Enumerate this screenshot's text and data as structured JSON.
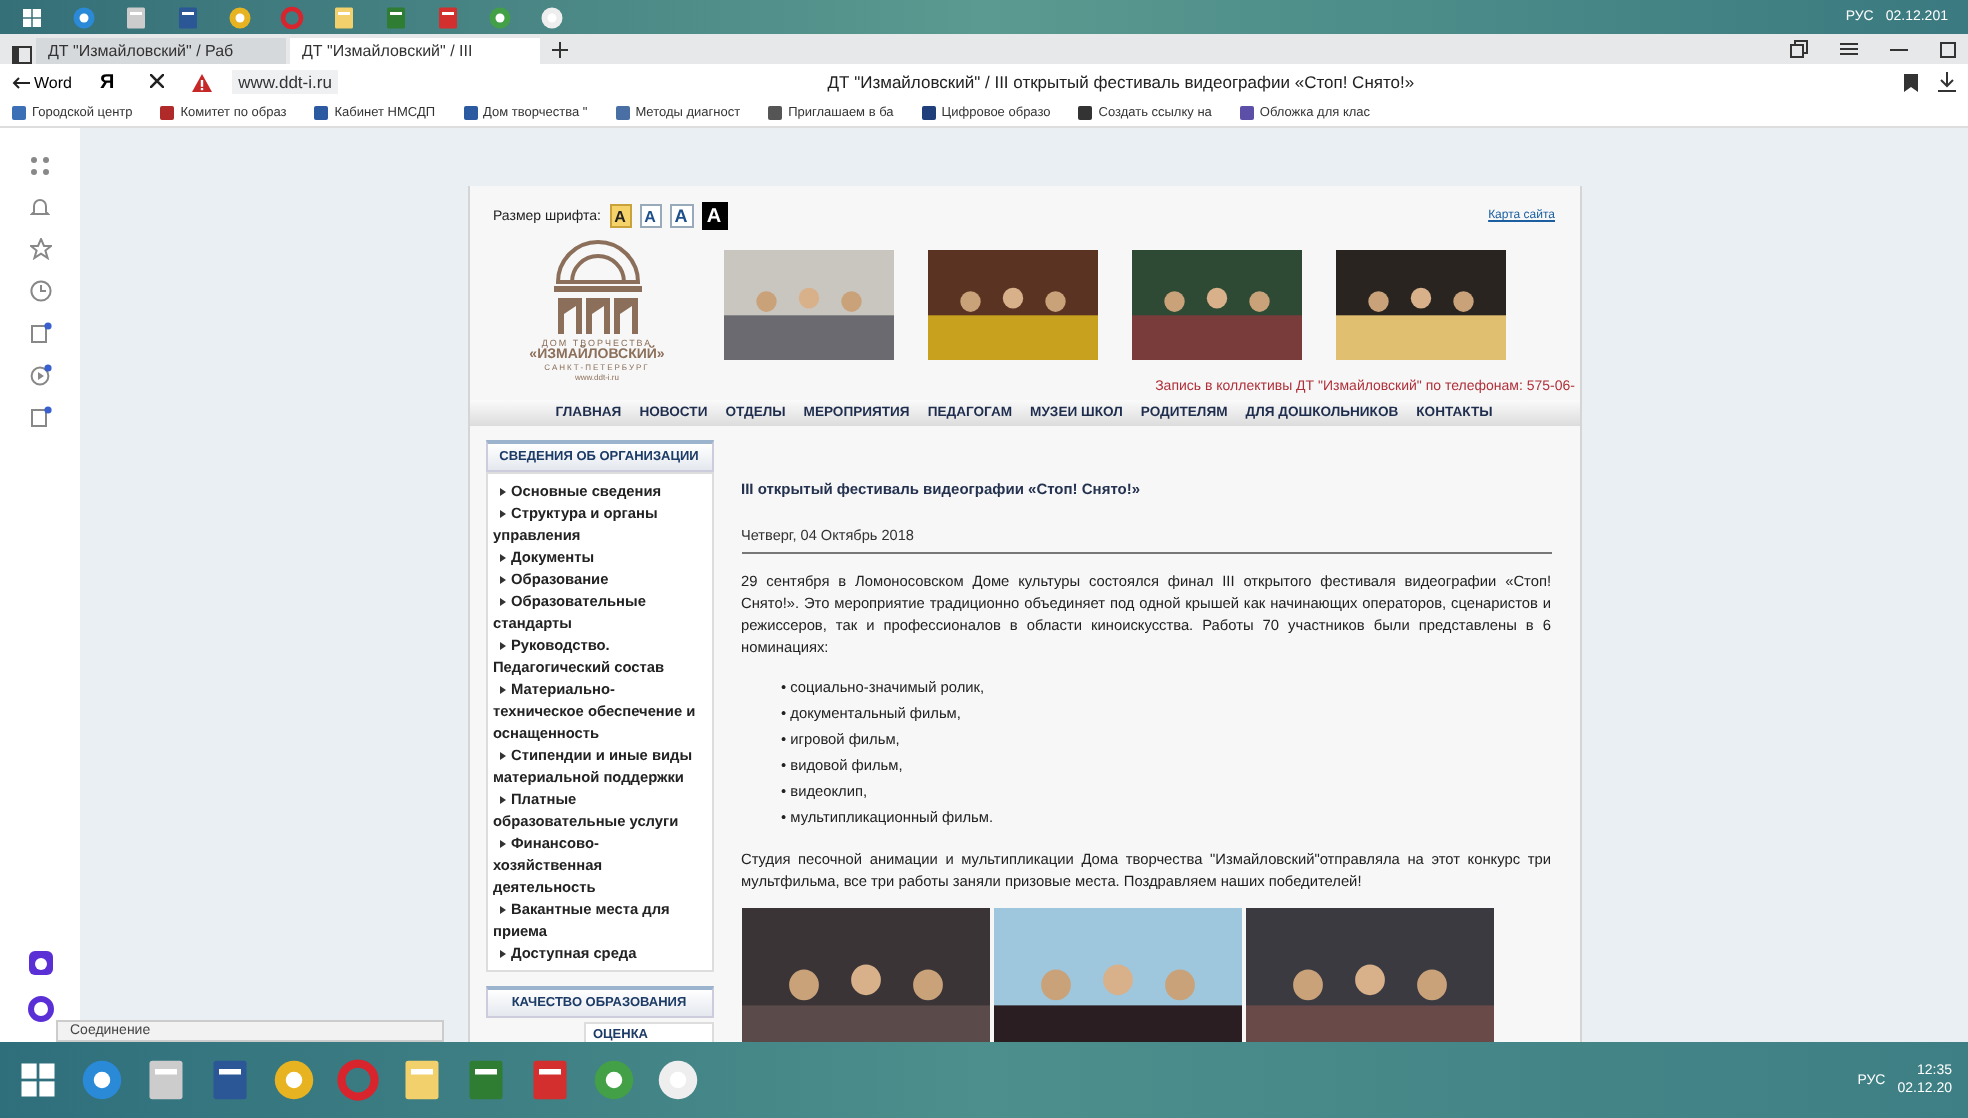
{
  "system_tray_top": {
    "language": "РУС",
    "date": "02.12.201"
  },
  "browser": {
    "tabs": [
      {
        "label": "ДТ \"Измайловский\" / Раб",
        "selected": false
      },
      {
        "label": "ДТ \"Измайловский\" / III",
        "selected": true
      }
    ],
    "back_label": "Word",
    "home_letter": "Я",
    "url": "www.ddt-i.ru",
    "page_title": "ДТ \"Измайловский\" / III открытый фестиваль видеографии «Стоп! Снято!»",
    "bookmarks": [
      {
        "label": "Городской центр",
        "color": "#3b6fb6"
      },
      {
        "label": "Комитет по образ",
        "color": "#b02a2a"
      },
      {
        "label": "Кабинет НМСДП",
        "color": "#2c5aa0"
      },
      {
        "label": "Дом творчества \"",
        "color": "#2c5aa0"
      },
      {
        "label": "Методы диагност",
        "color": "#4a6fa5"
      },
      {
        "label": "Приглашаем в ба",
        "color": "#555555"
      },
      {
        "label": "Цифровое образо",
        "color": "#1f3f7a"
      },
      {
        "label": "Создать ссылку на",
        "color": "#333333"
      },
      {
        "label": "Обложка для клас",
        "color": "#5b4fa8"
      }
    ]
  },
  "page": {
    "font_size_label": "Размер шрифта:",
    "font_size_buttons": [
      {
        "label": "A",
        "kind": "highlight"
      },
      {
        "label": "A",
        "kind": "plain"
      },
      {
        "label": "A",
        "kind": "large"
      },
      {
        "label": "A",
        "kind": "inverse"
      }
    ],
    "sitemap_link": "Карта сайта",
    "logo": {
      "line_1": "ДОМ ТВОРЧЕСТВА",
      "line_2": "«ИЗМАЙЛОВСКИЙ»",
      "line_3": "САНКТ-ПЕТЕРБУРГ",
      "line_4": "www.ddt-i.ru"
    },
    "enrollment_note": "Запись в коллективы ДТ \"Измайловский\" по телефонам: 575-06-",
    "nav": [
      "ГЛАВНАЯ",
      "НОВОСТИ",
      "ОТДЕЛЫ",
      "МЕРОПРИЯТИЯ",
      "ПЕДАГОГАМ",
      "МУЗЕИ ШКОЛ",
      "РОДИТЕЛЯМ",
      "ДЛЯ ДОШКОЛЬНИКОВ",
      "КОНТАКТЫ"
    ],
    "sidebar": {
      "sections": [
        {
          "title": "СВЕДЕНИЯ ОБ ОРГАНИЗАЦИИ",
          "items": [
            "Основные сведения",
            "Структура и органы управления",
            "Документы",
            "Образование",
            "Образовательные стандарты",
            "Руководство. Педагогический состав",
            "Материально-техническое обеспечение и оснащенность",
            "Стипендии и иные виды материальной поддержки",
            "Платные образовательные услуги",
            "Финансово-хозяйственная деятельность",
            "Вакантные места для приема",
            "Доступная среда"
          ]
        },
        {
          "title": "КАЧЕСТВО ОБРАЗОВАНИЯ"
        }
      ],
      "sub_heading": "ОЦЕНКА"
    },
    "article": {
      "title": "III открытый фестиваль видеографии «Стоп! Снято!»",
      "date": "Четверг, 04 Октябрь 2018",
      "intro": "29 сентября в Ломоносовском Доме культуры состоялся финал III открытого фестиваля видеографии «Стоп! Снято!». Это мероприятие традиционно объединяет под одной крышей как начинающих операторов, сценаристов и режиссеров, так и профессионалов в области киноискусства. Работы 70 участников были представлены в 6 номинациях:",
      "nominations": [
        {
          "marker": "•",
          "text": "социально-значимый ролик,"
        },
        {
          "marker": "•",
          "text": "документальный фильм,"
        },
        {
          "marker": "•",
          "text": "игровой фильм,"
        },
        {
          "marker": "•",
          "text": "видовой фильм,"
        },
        {
          "marker": "•",
          "text": "видеоклип,"
        },
        {
          "marker": "•",
          "text": "мультипликационный фильм."
        }
      ],
      "outro": "Студия песочной анимации и мультипликации Дома творчества \"Измайловский\"отправляла на этот конкурс три мультфильма, все три работы заняли призовые места. Поздравляем наших победителей!"
    }
  },
  "status_text": "Соединение",
  "taskbar": {
    "language": "РУС",
    "time": "12:35",
    "date": "02.12.20"
  }
}
